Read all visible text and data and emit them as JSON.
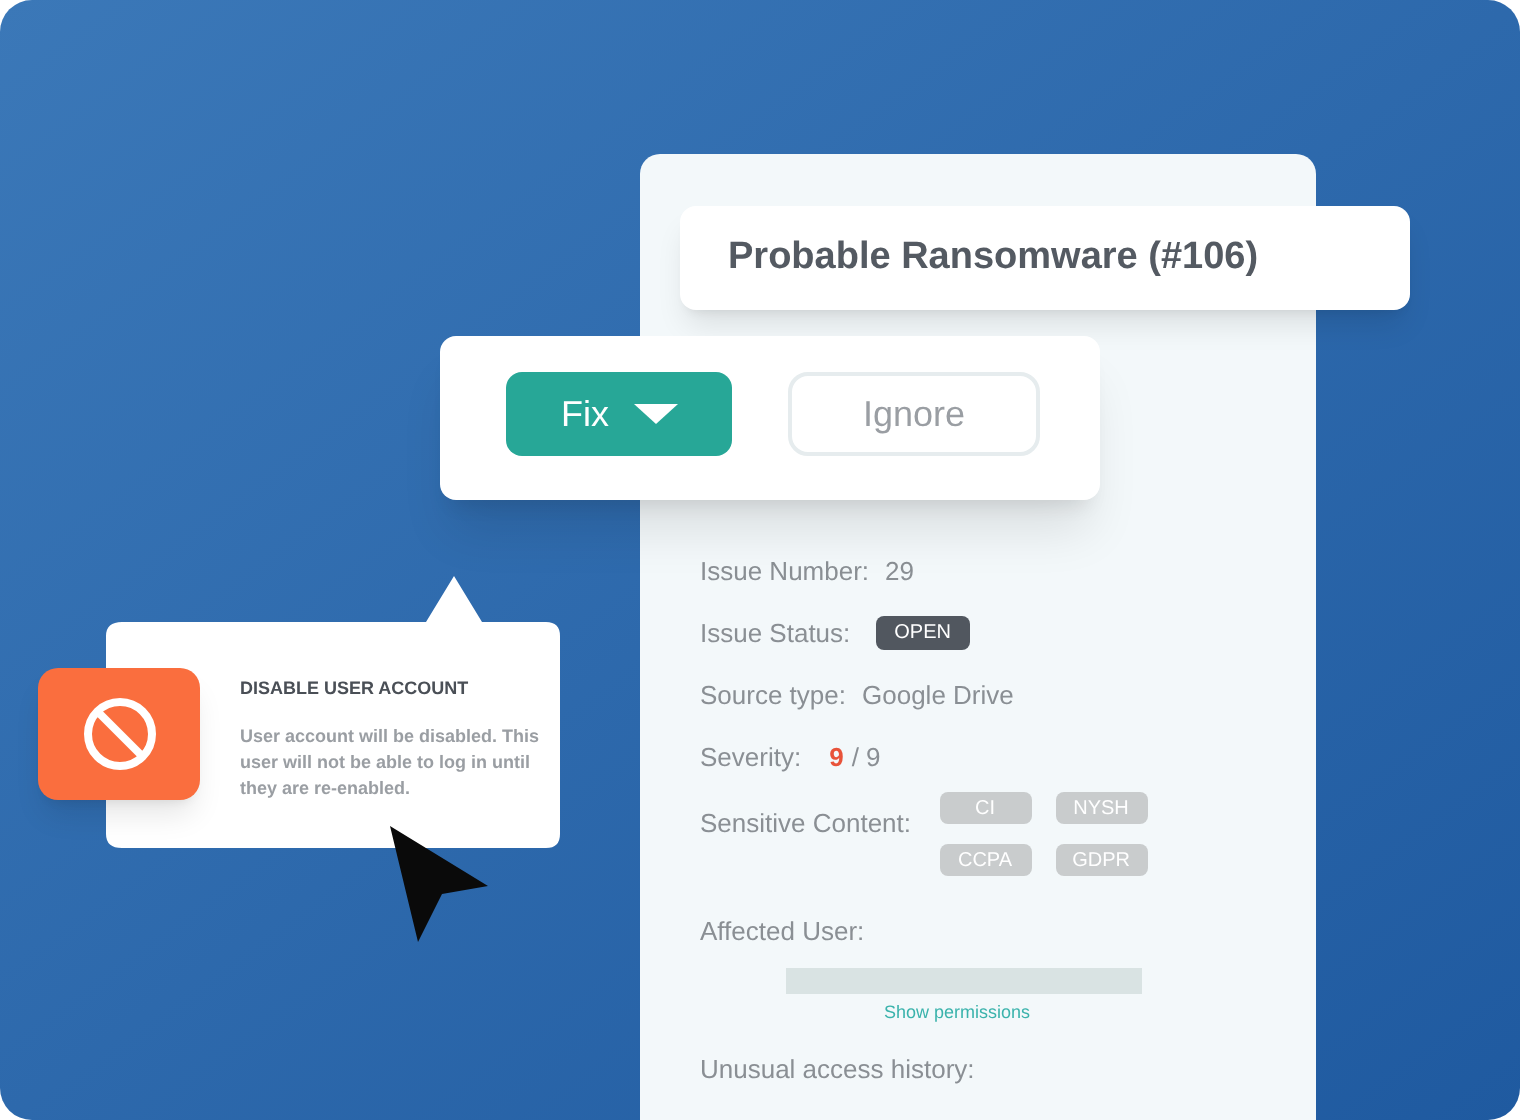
{
  "issue_title": "Probable Ransomware (#106)",
  "actions": [
    {
      "label": "Fix",
      "kind": "primary"
    },
    {
      "label": "Ignore",
      "kind": "secondary"
    }
  ],
  "details": [
    {
      "kind": "text",
      "label": "Issue Number:",
      "value": "29"
    },
    {
      "kind": "badge",
      "label": "Issue Status:",
      "value": "OPEN"
    },
    {
      "kind": "text",
      "label": "Source type:",
      "value": "Google Drive"
    },
    {
      "kind": "score",
      "label": "Severity:",
      "value": "9",
      "total": "/ 9"
    },
    {
      "kind": "tags",
      "label": "Sensitive Content:",
      "tags": [
        "CI",
        "NYSH",
        "CCPA",
        "GDPR"
      ]
    },
    {
      "kind": "user",
      "label": "Affected User:",
      "link": "Show permissions"
    },
    {
      "kind": "text",
      "label": "Unusual access history:"
    }
  ],
  "popup": {
    "title": "DISABLE USER ACCOUNT",
    "body": "User account will be disabled. This user will not be able to log in until they are re-enabled."
  }
}
